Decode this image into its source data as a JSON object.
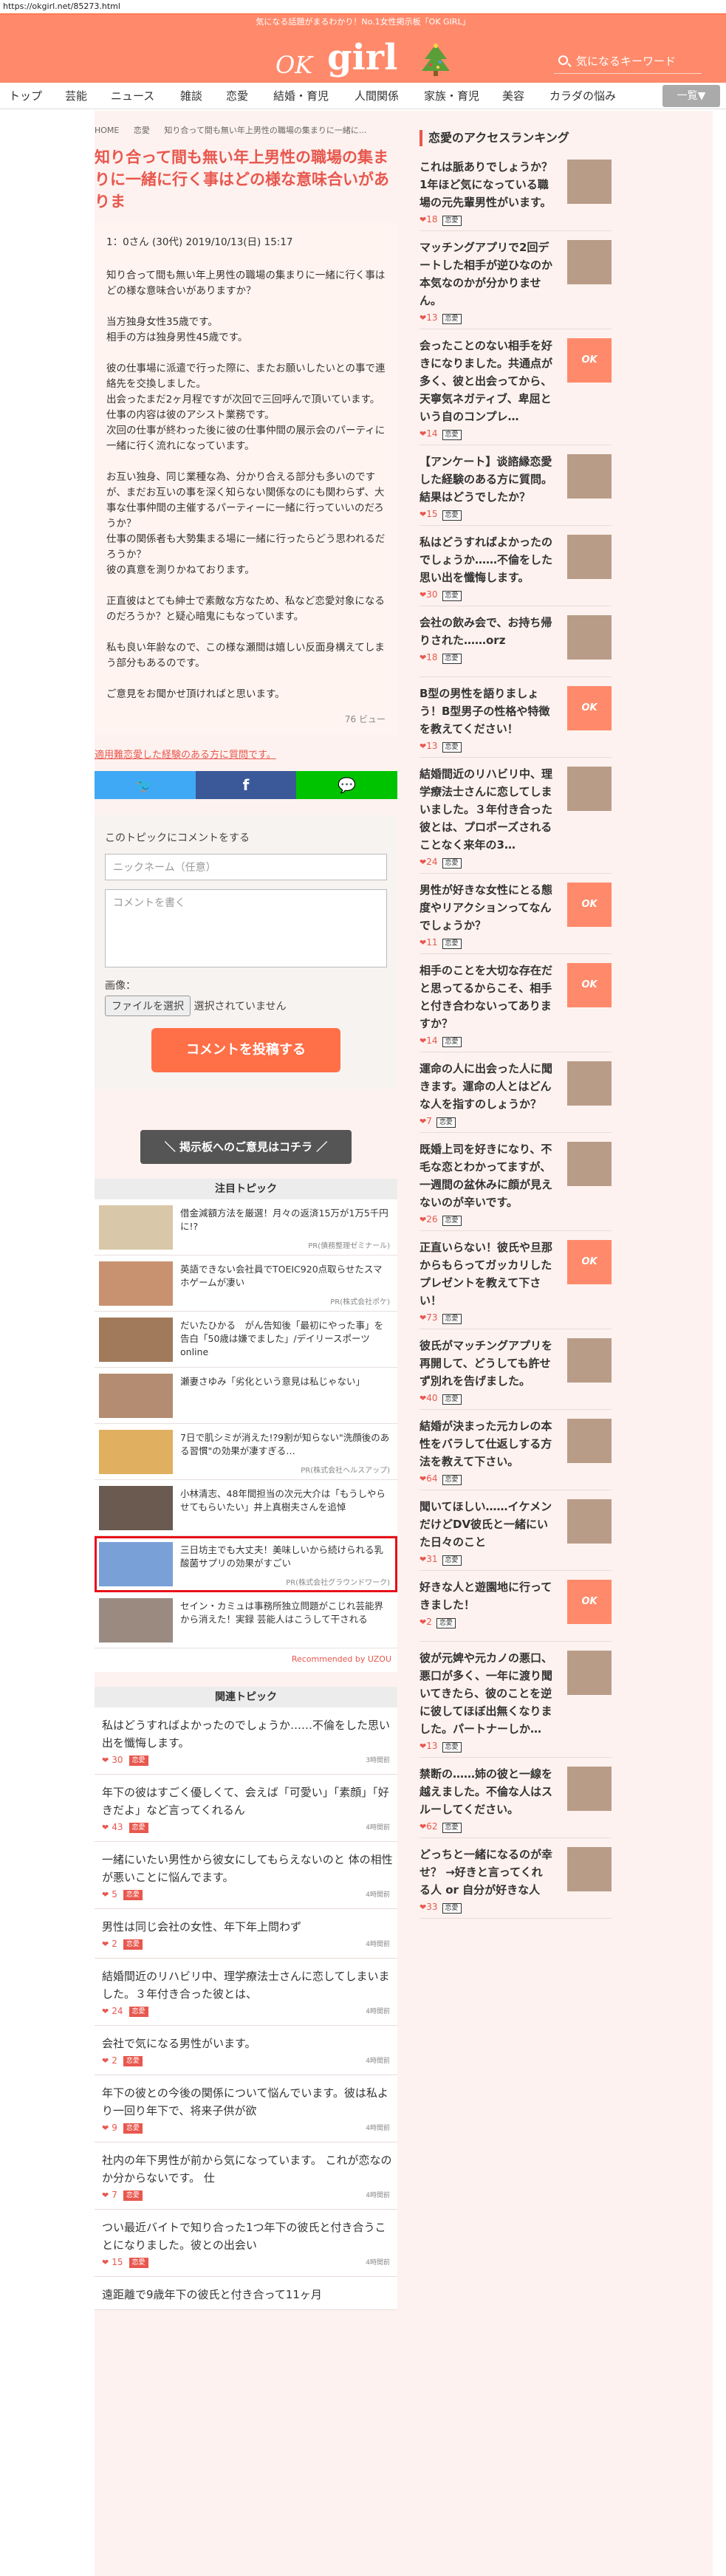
{
  "url": "https://okgirl.net/85273.html",
  "header": {
    "tagline": "気になる話題がまるわかり！No.1女性掲示板「OK GIRL」",
    "logo_ok": "OK",
    "logo_girl": "girl",
    "search_placeholder": "気になるキーワード"
  },
  "nav": {
    "items": [
      "トップ",
      "芸能",
      "ニュース",
      "雑談",
      "恋愛",
      "結婚・育児",
      "人間関係",
      "家族・育児",
      "美容",
      "カラダの悩み"
    ],
    "more": "一覧▼"
  },
  "breadcrumb": [
    "HOME",
    "恋愛",
    "知り合って間も無い年上男性の職場の集まりに一緒に..."
  ],
  "article": {
    "title": "知り合って間も無い年上男性の職場の集まりに一緒に行く事はどの様な意味合いがありま",
    "meta": "1：0さん (30代) 2019/10/13(日) 15:17",
    "paragraphs": [
      "知り合って間も無い年上男性の職場の集まりに一緒に行く事はどの様な意味合いがありますか？",
      "当方独身女性35歳です。\n相手の方は独身男性45歳です。",
      "彼の仕事場に派遣で行った際に、またお願いしたいとの事で連絡先を交換しました。\n出会ったまだ2ヶ月程ですが次回で三回呼んで頂いています。\n仕事の内容は彼のアシスト業務です。\n次回の仕事が終わった後に彼の仕事仲間の展示会のパーティに一緒に行く流れになっています。",
      "お互い独身、同じ業種な為、分かり合える部分も多いのですが、まだお互いの事を深く知らない関係なのにも関わらず、大事な仕事仲間の主催するパーティーに一緒に行っていいのだろうか？\n仕事の関係者も大勢集まる場に一緒に行ったらどう思われるだろうか？\n彼の真意を測りかねております。",
      "正直彼はとても紳士で素敵な方なため、私など恋愛対象になるのだろうか？と疑心暗鬼にもなっています。",
      "私も良い年齢なので、この様な瀬間は嬉しい反面身構えてしまう部分もあるのです。",
      "ご意見をお聞かせ頂ければと思います。"
    ],
    "views": "76 ビュー",
    "report_link": "適用難恋愛した経験のある方に質問です。"
  },
  "share": {
    "twitter": "🐦",
    "facebook": "f",
    "line": "💬"
  },
  "comment_form": {
    "heading": "このトピックにコメントをする",
    "name_placeholder": "ニックネーム（任意）",
    "comment_placeholder": "コメントを書く",
    "image_label": "画像：",
    "file_button": "ファイルを選択",
    "file_status": "選択されていません",
    "submit": "コメントを投稿する"
  },
  "opinion_button": "＼ 掲示板へのご意見はコチラ ／",
  "featured": {
    "heading": "注目トピック",
    "items": [
      {
        "text": "借金減額方法を厳選！月々の返済15万が1万5千円に!?",
        "sponsor": "PR(債務整理ゼミナール)"
      },
      {
        "text": "英語できない会社員でTOEIC920点取らせたスマホゲームが凄い",
        "sponsor": "PR(株式会社ポケ)"
      },
      {
        "text": "だいたひかる　がん告知後「最初にやった事」を告白「50歳は嫌でました」/デイリースポーツ online",
        "sponsor": ""
      },
      {
        "text": "瀬妻さゆみ「劣化という意見は私じゃない」",
        "sponsor": ""
      },
      {
        "text": "7日で肌シミが消えた!?9割が知らない\"洗顔後のある習慣\"の効果が凄すぎる…",
        "sponsor": "PR(株式会社ヘルスアップ)"
      },
      {
        "text": "小林清志、48年間担当の次元大介は「もうしやらせてもらいたい」井上真樹夫さんを追悼",
        "sponsor": ""
      },
      {
        "text": "三日坊主でも大丈夫！美味しいから続けられる乳酸菌サプリの効果がすごい",
        "sponsor": "PR(株式会社グラウンドワーク)"
      },
      {
        "text": "セイン・カミュは事務所独立問題がこじれ芸能界から消えた！実録 芸能人はこうして干される",
        "sponsor": ""
      }
    ],
    "recommended_by": "Recommended by UZOU"
  },
  "related": {
    "heading": "関連トピック",
    "items": [
      {
        "title": "私はどうすればよかったのでしょうか……不倫をした思い出を懺悔します。",
        "count": "30",
        "tag": "恋愛",
        "date": "3時間前"
      },
      {
        "title": "年下の彼はすごく優しくて、会えば「可愛い」「素顔」「好きだよ」など言ってくれるん",
        "count": "43",
        "tag": "恋愛",
        "date": "4時間前"
      },
      {
        "title": "一緒にいたい男性から彼女にしてもらえないのと 体の相性が悪いことに悩んでます。",
        "count": "5",
        "tag": "恋愛",
        "date": "4時間前"
      },
      {
        "title": "男性は同じ会社の女性、年下年上問わず",
        "count": "2",
        "tag": "恋愛",
        "date": "4時間前"
      },
      {
        "title": "結婚間近のリハビリ中、理学療法士さんに恋してしまいました。３年付き合った彼とは、",
        "count": "24",
        "tag": "恋愛",
        "date": "4時間前"
      },
      {
        "title": "会社で気になる男性がいます。",
        "count": "2",
        "tag": "恋愛",
        "date": "4時間前"
      },
      {
        "title": "年下の彼との今後の関係について悩んでいます。彼は私より一回り年下で、将来子供が欲",
        "count": "9",
        "tag": "恋愛",
        "date": "4時間前"
      },
      {
        "title": "社内の年下男性が前から気になっています。 これが恋なのか分からないです。 仕",
        "count": "7",
        "tag": "恋愛",
        "date": "4時間前"
      },
      {
        "title": "つい最近バイトで知り合った1つ年下の彼氏と付き合うことになりました。彼との出会い",
        "count": "15",
        "tag": "恋愛",
        "date": "4時間前"
      },
      {
        "title": "遠距離で9歳年下の彼氏と付き合って11ヶ月",
        "count": "",
        "tag": "",
        "date": ""
      }
    ]
  },
  "ranking": {
    "heading": "恋愛のアクセスランキング",
    "items": [
      {
        "title": "これは脈ありでしょうか？1年ほど気になっている職場の元先輩男性がいます。",
        "count": "18",
        "tag": "恋愛",
        "thumb": "photo"
      },
      {
        "title": "マッチングアプリで2回デートした相手が逆ひなのか本気なのかが分かりません。",
        "count": "13",
        "tag": "恋愛",
        "thumb": "photo"
      },
      {
        "title": "会ったことのない相手を好きになりました。共通点が多く、彼と出会ってから、天寧気ネガティブ、卑屈という自のコンプレ…",
        "count": "14",
        "tag": "恋愛",
        "thumb": "okgirl"
      },
      {
        "title": "【アンケート】谈諮縁恋愛した経験のある方に質問。結果はどうでしたか？",
        "count": "15",
        "tag": "恋愛",
        "thumb": "photo"
      },
      {
        "title": "私はどうすればよかったのでしょうか……不倫をした思い出を懺悔します。",
        "count": "30",
        "tag": "恋愛",
        "thumb": "photo"
      },
      {
        "title": "会社の飲み会で、お持ち帰りされた……orz",
        "count": "18",
        "tag": "恋愛",
        "thumb": "photo"
      },
      {
        "title": "B型の男性を語りましょう！B型男子の性格や特徴を教えてください！",
        "count": "13",
        "tag": "恋愛",
        "thumb": "okgirl"
      },
      {
        "title": "結婚間近のリハビリ中、理学療法士さんに恋してしまいました。３年付き合った彼とは、プロポーズされることなく来年の3…",
        "count": "24",
        "tag": "恋愛",
        "thumb": "photo"
      },
      {
        "title": "男性が好きな女性にとる態度やリアクションってなんでしょうか？",
        "count": "11",
        "tag": "恋愛",
        "thumb": "okgirl"
      },
      {
        "title": "相手のことを大切な存在だと思ってるからこそ、相手と付き合わないってありますか？",
        "count": "14",
        "tag": "恋愛",
        "thumb": "okgirl"
      },
      {
        "title": "運命の人に出会った人に聞きます。運命の人とはどんな人を指すのしょうか？",
        "count": "7",
        "tag": "恋愛",
        "thumb": "photo"
      },
      {
        "title": "既婚上司を好きになり、不毛な恋とわかってますが、一週間の盆休みに顔が見えないのが辛いです。",
        "count": "26",
        "tag": "恋愛",
        "thumb": "photo"
      },
      {
        "title": "正直いらない！彼氏や旦那からもらってガッカリしたプレゼントを教えて下さい！",
        "count": "73",
        "tag": "恋愛",
        "thumb": "okgirl"
      },
      {
        "title": "彼氏がマッチングアプリを再開して、どうしても許せず別れを告げました。",
        "count": "40",
        "tag": "恋愛",
        "thumb": "photo"
      },
      {
        "title": "結婚が決まった元カレの本性をバラして仕返しする方法を教えて下さい。",
        "count": "64",
        "tag": "恋愛",
        "thumb": "photo"
      },
      {
        "title": "聞いてほしい……イケメンだけどDV彼氏と一緒にいた日々のこと",
        "count": "31",
        "tag": "恋愛",
        "thumb": "photo"
      },
      {
        "title": "好きな人と遊園地に行ってきました！",
        "count": "2",
        "tag": "恋愛",
        "thumb": "okgirl"
      },
      {
        "title": "彼が元婢や元カノの悪口、悪口が多く、一年に渡り聞いてきたら、彼のことを逆に彼してほぼ出無くなりました。パートナーしか…",
        "count": "13",
        "tag": "恋愛",
        "thumb": "photo"
      },
      {
        "title": "禁断の……姉の彼と一線を越えました。不倫な人はスルーしてください。",
        "count": "62",
        "tag": "恋愛",
        "thumb": "photo"
      },
      {
        "title": "どっちと一緒になるのが幸せ？ →好きと言ってくれる人 or 自分が好きな人",
        "count": "33",
        "tag": "恋愛",
        "thumb": "photo"
      }
    ]
  }
}
